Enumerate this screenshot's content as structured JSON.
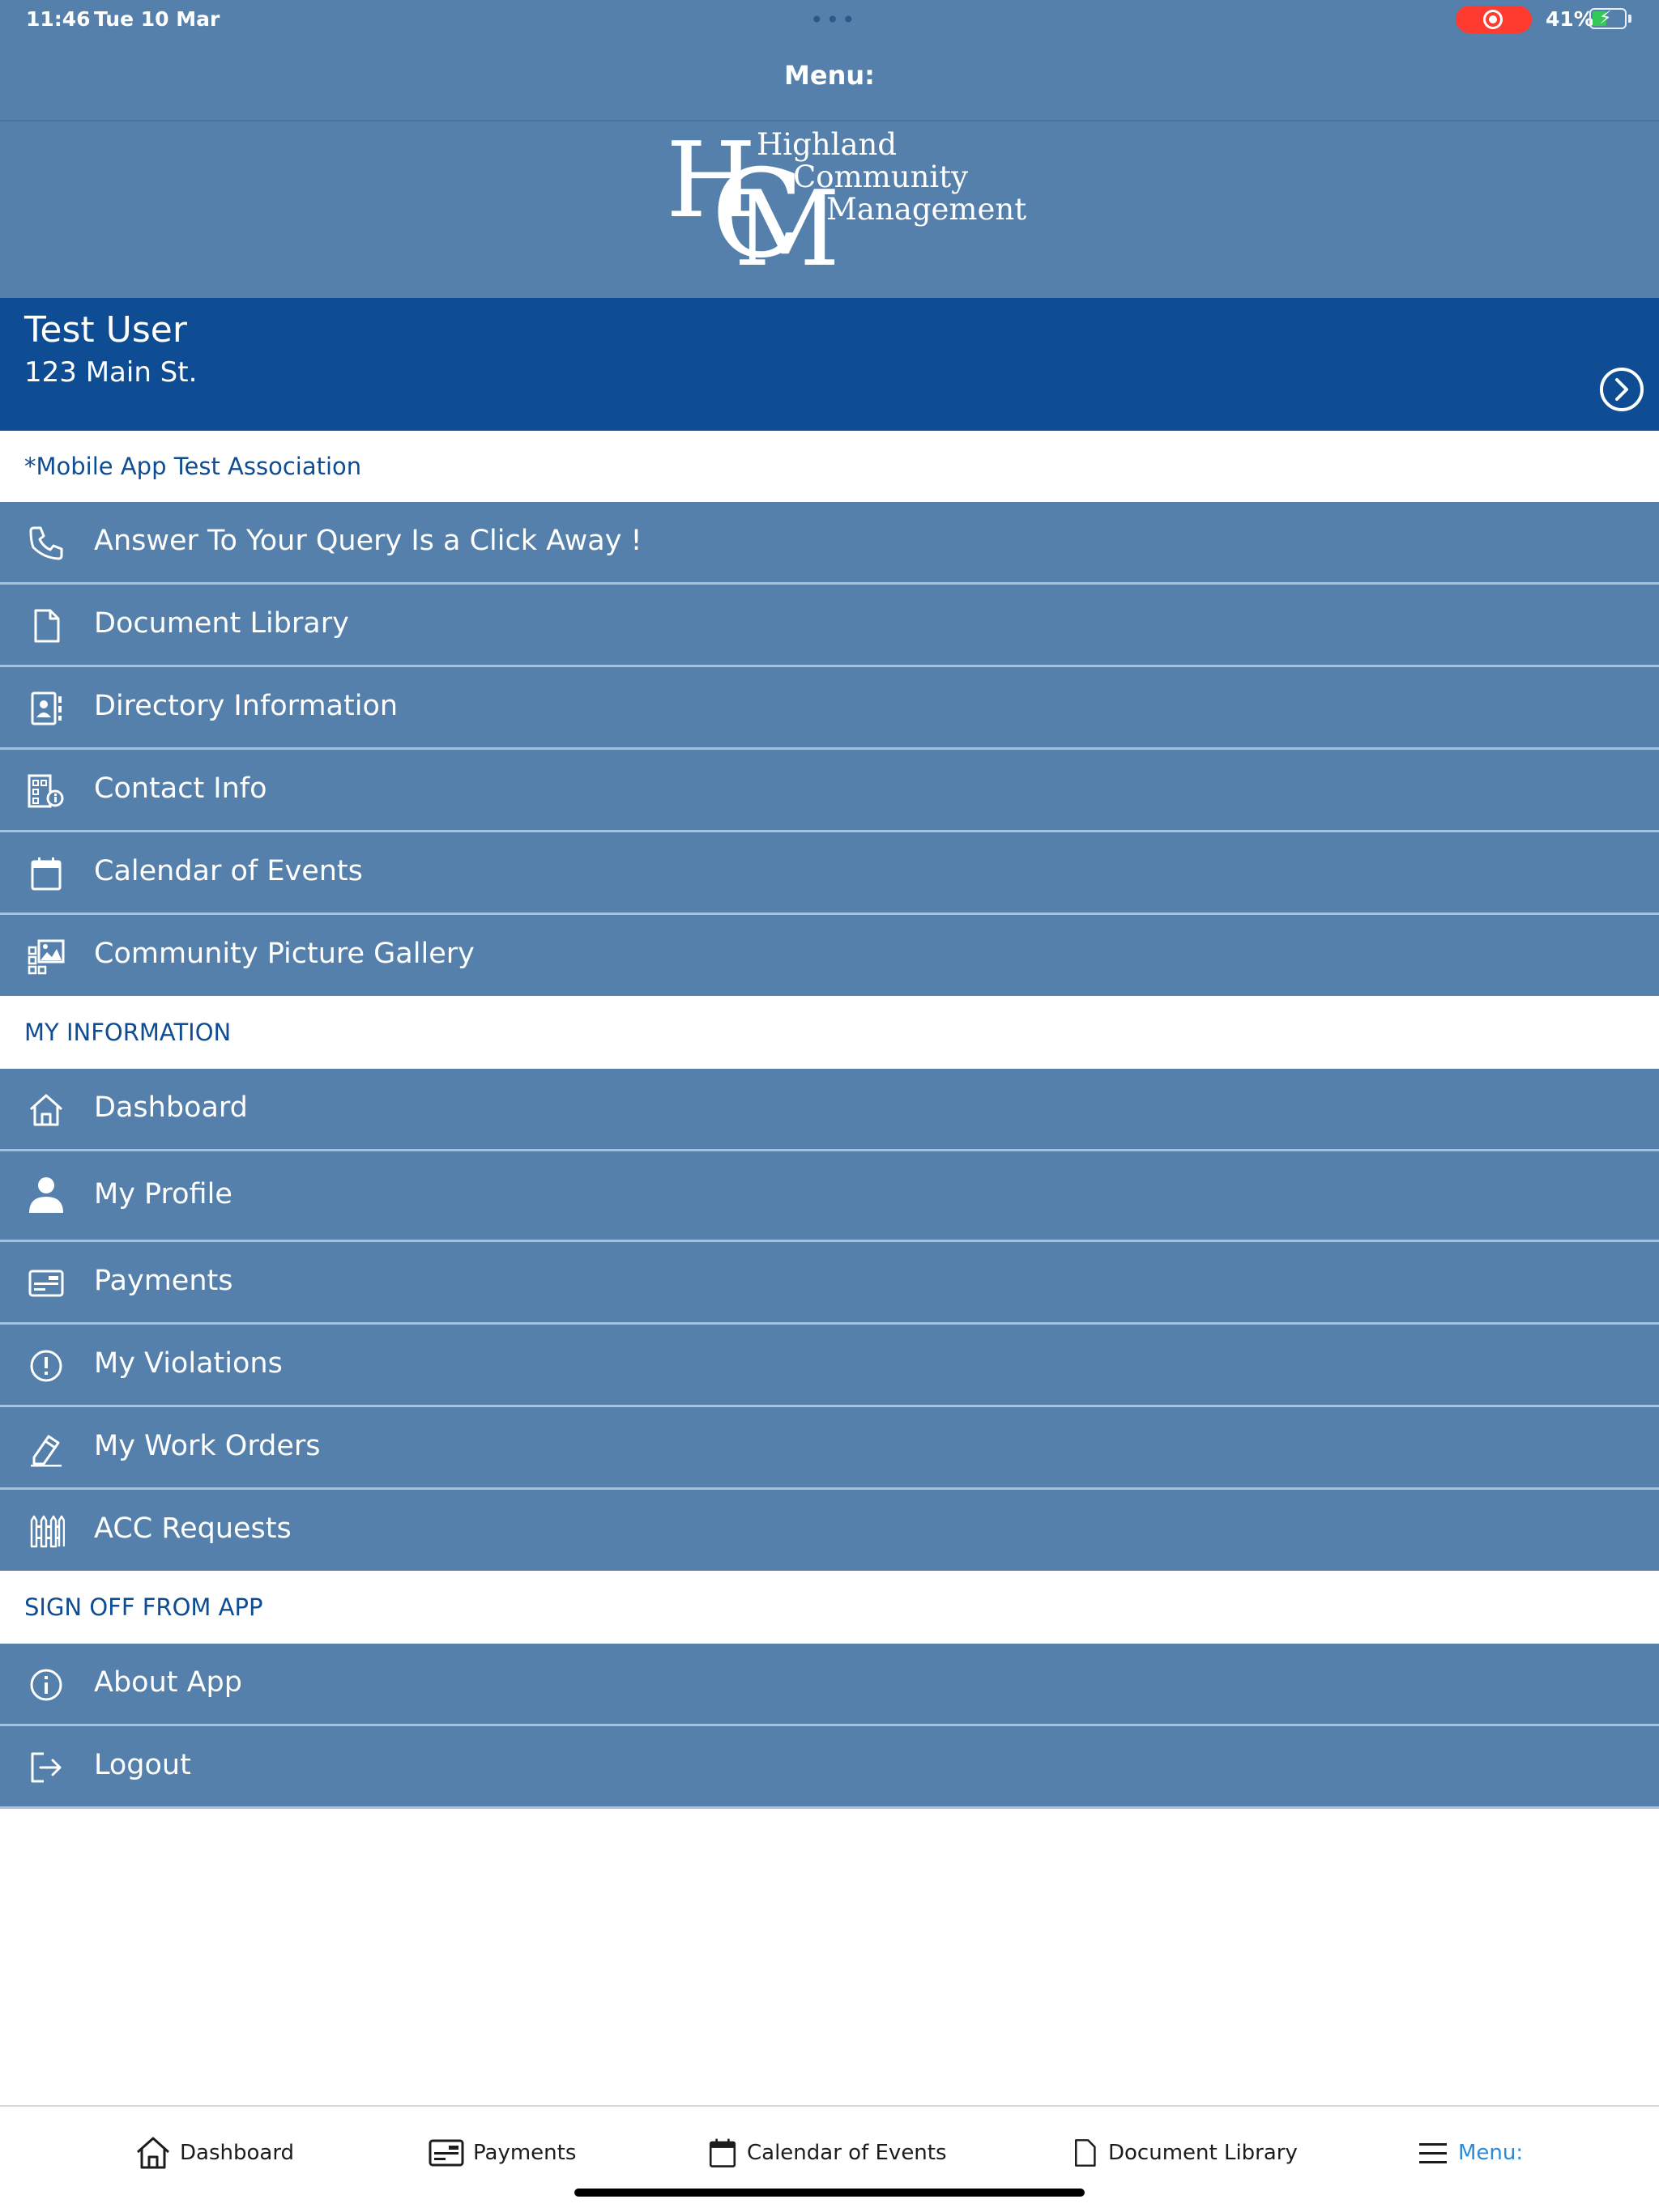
{
  "status_bar": {
    "time": "11:46",
    "date": "Tue 10 Mar",
    "battery": "41%",
    "dots": "•••"
  },
  "nav": {
    "title": "Menu:"
  },
  "logo": {
    "mark_h": "H",
    "mark_c": "C",
    "mark_m": "M",
    "line1": "Highland",
    "line2": "Community",
    "line3": "Management"
  },
  "user": {
    "name": "Test User",
    "address": "123 Main St."
  },
  "association": {
    "header": "*Mobile App Test Association"
  },
  "association_items": [
    {
      "label": "Answer To Your Query Is a Click Away !",
      "icon": "phone-icon"
    },
    {
      "label": "Document Library",
      "icon": "document-icon"
    },
    {
      "label": "Directory Information",
      "icon": "directory-icon"
    },
    {
      "label": "Contact Info",
      "icon": "contact-info-icon"
    },
    {
      "label": "Calendar of Events",
      "icon": "calendar-icon"
    },
    {
      "label": "Community Picture Gallery",
      "icon": "gallery-icon"
    }
  ],
  "my_information": {
    "header": "MY INFORMATION"
  },
  "my_information_items": [
    {
      "label": "Dashboard",
      "icon": "home-icon"
    },
    {
      "label": "My Profile",
      "icon": "person-icon"
    },
    {
      "label": "Payments",
      "icon": "payment-card-icon"
    },
    {
      "label": "My Violations",
      "icon": "exclamation-circle-icon"
    },
    {
      "label": "My Work Orders",
      "icon": "work-order-icon"
    },
    {
      "label": "ACC Requests",
      "icon": "fence-icon"
    }
  ],
  "sign_off": {
    "header": "SIGN OFF FROM APP"
  },
  "sign_off_items": [
    {
      "label": "About App",
      "icon": "info-circle-icon"
    },
    {
      "label": "Logout",
      "icon": "logout-icon"
    }
  ],
  "tabbar": [
    {
      "label": "Dashboard",
      "icon": "home-icon"
    },
    {
      "label": "Payments",
      "icon": "payment-card-icon"
    },
    {
      "label": "Calendar of Events",
      "icon": "calendar-icon"
    },
    {
      "label": "Document Library",
      "icon": "document-icon"
    },
    {
      "label": "Menu:",
      "icon": "hamburger-menu-icon",
      "active": true
    }
  ],
  "colors": {
    "nav_blue": "#5480ab",
    "banner_blue": "#0e4d94",
    "active_tab": "#2f8ad6",
    "recording": "#ff3b30",
    "battery": "#34c759"
  }
}
